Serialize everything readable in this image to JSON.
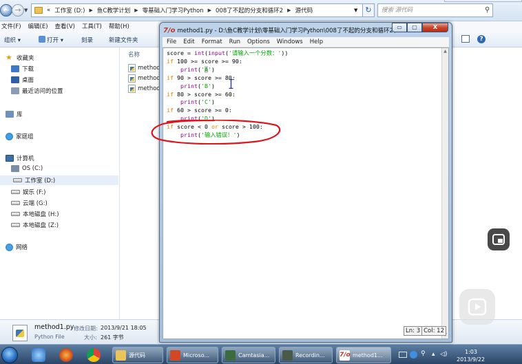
{
  "explorer": {
    "breadcrumb": [
      "«",
      "工作室 (D:)",
      "鱼C教学计划",
      "零基础入门学习Python",
      "008了不起的分支和循环2",
      "源代码"
    ],
    "search_placeholder": "搜索 源代码",
    "menu": [
      "文件(F)",
      "编辑(E)",
      "查看(V)",
      "工具(T)",
      "帮助(H)"
    ],
    "toolbar": {
      "organize": "组织 ▾",
      "open": "打开 ▾",
      "burn": "刻录",
      "new_folder": "新建文件夹"
    },
    "nav": {
      "favorites": "收藏夹",
      "downloads": "下载",
      "desktop": "桌面",
      "recent": "最近访问的位置",
      "libraries": "库",
      "homegroup": "家庭组",
      "computer": "计算机",
      "drives": [
        "OS (C:)",
        "工作室 (D:)",
        "娱乐 (F:)",
        "云端 (G:)",
        "本地磁盘 (H:)",
        "本地磁盘 (Z:)"
      ],
      "network": "网络"
    },
    "column_name": "名称",
    "files": [
      "method",
      "method",
      "method"
    ],
    "details": {
      "name": "method1.py",
      "modified_label": "修改日期:",
      "modified_value": "2013/9/21 18:05",
      "type": "Python File",
      "size_label": "大小:",
      "size_value": "261 字节"
    }
  },
  "idle": {
    "logo": "7/o",
    "title": "method1.py - D:\\鱼C教学计划\\零基础入门学习Python\\008了不起的分支和循环2\\...",
    "controls": [
      "▭",
      "▢",
      "X"
    ],
    "menu": [
      "File",
      "Edit",
      "Format",
      "Run",
      "Options",
      "Windows",
      "Help"
    ],
    "code": {
      "l1_a": "score = ",
      "l1_b": "int",
      "l1_c": "(",
      "l1_d": "input",
      "l1_e": "(",
      "l1_f": "'请输入一个分数：'",
      "l1_g": "))",
      "l2_a": "if",
      "l2_b": " 100 >= score >= 90:",
      "l3_a": "    ",
      "l3_b": "print",
      "l3_c": "(",
      "l3_d": "'",
      "l3_e": "A",
      "l3_f": "'",
      "l3_g": ")",
      "l4_a": "if",
      "l4_b": " 90 > score >= 80:",
      "l5_a": "    ",
      "l5_b": "print",
      "l5_c": "(",
      "l5_d": "'B'",
      "l5_e": ")",
      "l6_a": "if",
      "l6_b": " 80 > score >= 60:",
      "l7_a": "    ",
      "l7_b": "print",
      "l7_c": "(",
      "l7_d": "'C'",
      "l7_e": ")",
      "l8_a": "if",
      "l8_b": " 60 > score >= 0:",
      "l9_a": "    ",
      "l9_b": "print",
      "l9_c": "(",
      "l9_d": "'D'",
      "l9_e": ")",
      "l10_a": "if",
      "l10_b": " score < 0 ",
      "l10_c": "or",
      "l10_d": " score > 100:",
      "l11_a": "    ",
      "l11_b": "print",
      "l11_c": "(",
      "l11_d": "'输入错误！'",
      "l11_e": ")"
    },
    "status_ln": "Ln: 3",
    "status_col": "Col: 12"
  },
  "taskbar": {
    "tasks": [
      "源代码",
      "Microso...",
      "Camtasia...",
      "Recordin...",
      "method1..."
    ],
    "time": "1:03",
    "date": "2013/9/22"
  },
  "colors": {
    "keyword": "#ff7700",
    "builtin": "#900090",
    "string": "#00aa00",
    "annotation": "#e0151b"
  }
}
